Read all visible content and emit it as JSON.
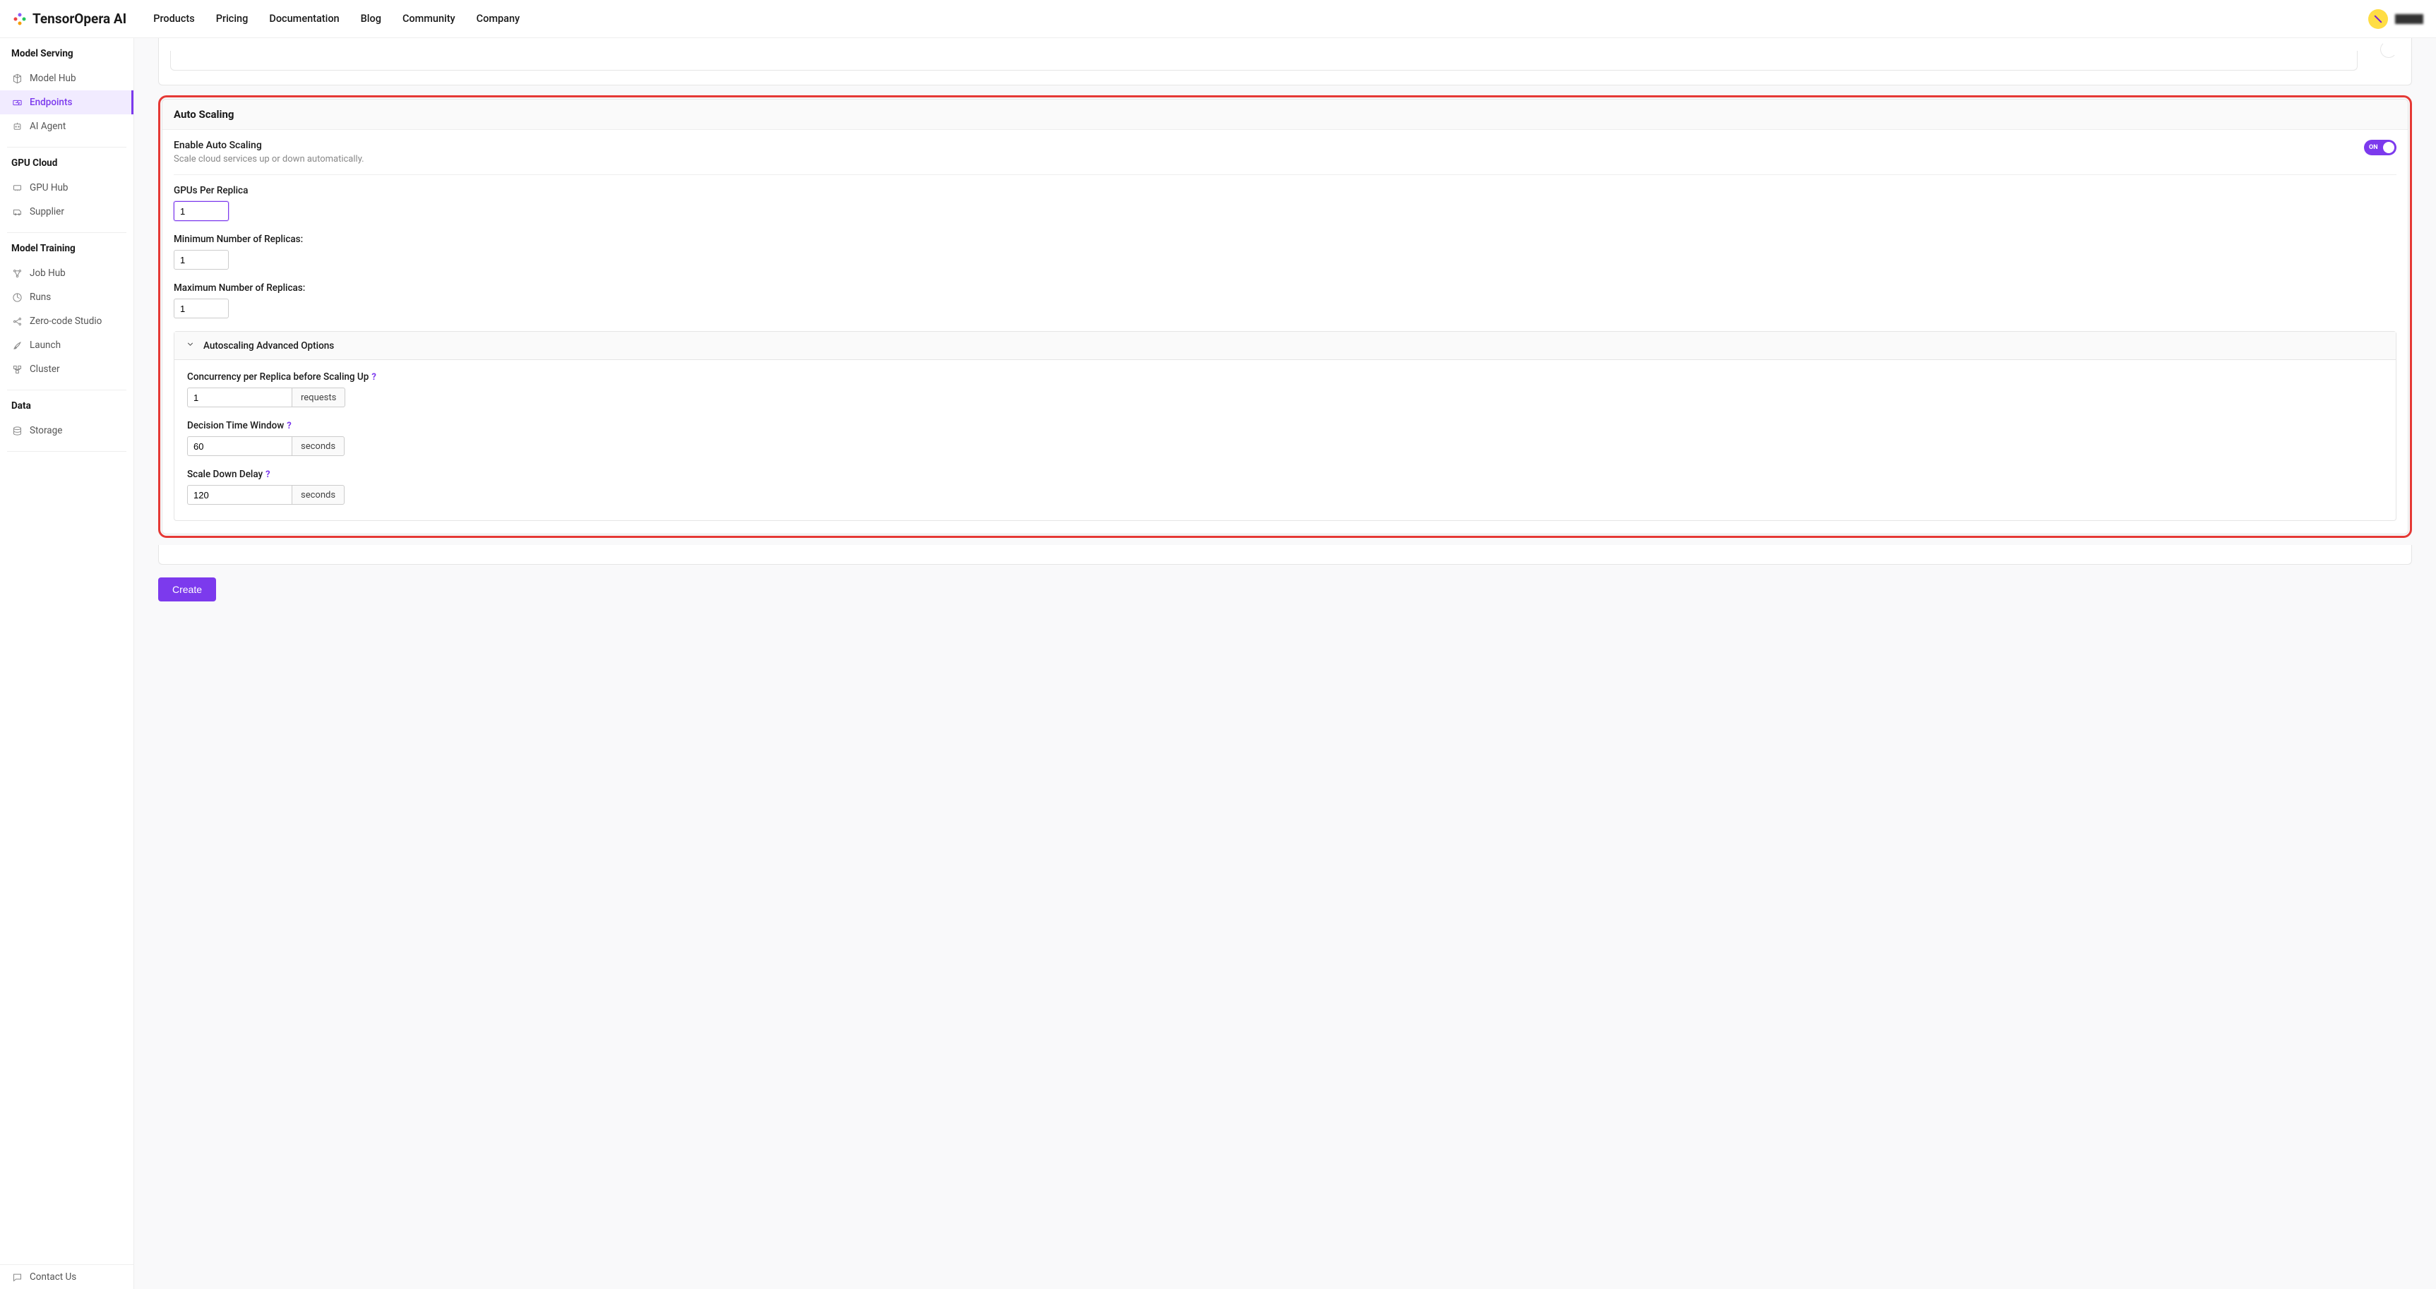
{
  "brand": "TensorOpera AI",
  "topnav": [
    "Products",
    "Pricing",
    "Documentation",
    "Blog",
    "Community",
    "Company"
  ],
  "sidebar": {
    "groups": [
      {
        "heading": "Model Serving",
        "items": [
          {
            "label": "Model Hub",
            "icon": "cube-icon"
          },
          {
            "label": "Endpoints",
            "icon": "endpoint-icon",
            "active": true
          },
          {
            "label": "AI Agent",
            "icon": "agent-icon"
          }
        ]
      },
      {
        "heading": "GPU Cloud",
        "items": [
          {
            "label": "GPU Hub",
            "icon": "gpu-icon"
          },
          {
            "label": "Supplier",
            "icon": "supplier-icon"
          }
        ]
      },
      {
        "heading": "Model Training",
        "items": [
          {
            "label": "Job Hub",
            "icon": "job-icon"
          },
          {
            "label": "Runs",
            "icon": "runs-icon"
          },
          {
            "label": "Zero-code Studio",
            "icon": "studio-icon"
          },
          {
            "label": "Launch",
            "icon": "launch-icon"
          },
          {
            "label": "Cluster",
            "icon": "cluster-icon"
          }
        ]
      },
      {
        "heading": "Data",
        "items": [
          {
            "label": "Storage",
            "icon": "storage-icon"
          }
        ]
      }
    ],
    "footer": {
      "label": "Contact Us",
      "icon": "chat-icon"
    }
  },
  "card": {
    "title": "Auto Scaling",
    "enable": {
      "label": "Enable Auto Scaling",
      "sub": "Scale cloud services up or down automatically.",
      "state": "ON"
    },
    "gpus": {
      "label": "GPUs Per Replica",
      "value": "1"
    },
    "min": {
      "label": "Minimum Number of Replicas:",
      "value": "1"
    },
    "max": {
      "label": "Maximum Number of Replicas:",
      "value": "1"
    },
    "adv": {
      "title": "Autoscaling Advanced Options",
      "concurrency": {
        "label": "Concurrency per Replica before Scaling Up",
        "value": "1",
        "unit": "requests"
      },
      "window": {
        "label": "Decision Time Window",
        "value": "60",
        "unit": "seconds"
      },
      "delay": {
        "label": "Scale Down Delay",
        "value": "120",
        "unit": "seconds"
      }
    }
  },
  "create": "Create"
}
